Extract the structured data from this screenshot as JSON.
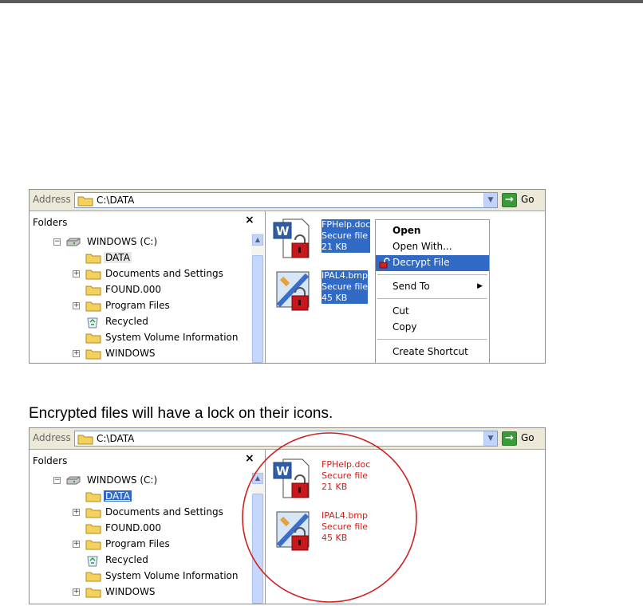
{
  "address_label": "Address",
  "address_path": "C:\\DATA",
  "go_label": "Go",
  "folders_title": "Folders",
  "close_glyph": "×",
  "tree": [
    {
      "label": "WINDOWS (C:)",
      "expander": "−",
      "icon": "drive-icon"
    },
    {
      "label": "DATA",
      "expander": "",
      "icon": "folder-icon"
    },
    {
      "label": "Documents and Settings",
      "expander": "+",
      "icon": "folder-icon"
    },
    {
      "label": "FOUND.000",
      "expander": "",
      "icon": "folder-icon"
    },
    {
      "label": "Program Files",
      "expander": "+",
      "icon": "folder-icon"
    },
    {
      "label": "Recycled",
      "expander": "",
      "icon": "recycle-bin-icon"
    },
    {
      "label": "System Volume Information",
      "expander": "",
      "icon": "folder-icon"
    },
    {
      "label": "WINDOWS",
      "expander": "+",
      "icon": "folder-icon"
    }
  ],
  "files": [
    {
      "name": "FPHelp.doc",
      "type": "Secure file",
      "size": "21 KB",
      "icon": "word-document-locked-icon"
    },
    {
      "name": "IPAL4.bmp",
      "type": "Secure file",
      "size": "45 KB",
      "icon": "bitmap-image-locked-icon"
    }
  ],
  "context_menu": {
    "open": "Open",
    "open_with": "Open With...",
    "decrypt": "Decrypt File",
    "send_to": "Send To",
    "cut": "Cut",
    "copy": "Copy",
    "create_shortcut": "Create Shortcut"
  },
  "caption": "Encrypted files will have a lock on their icons.",
  "colors": {
    "selection": "#316ac5",
    "encrypted_text": "#d2201a",
    "highlight_oval": "#d22020"
  }
}
